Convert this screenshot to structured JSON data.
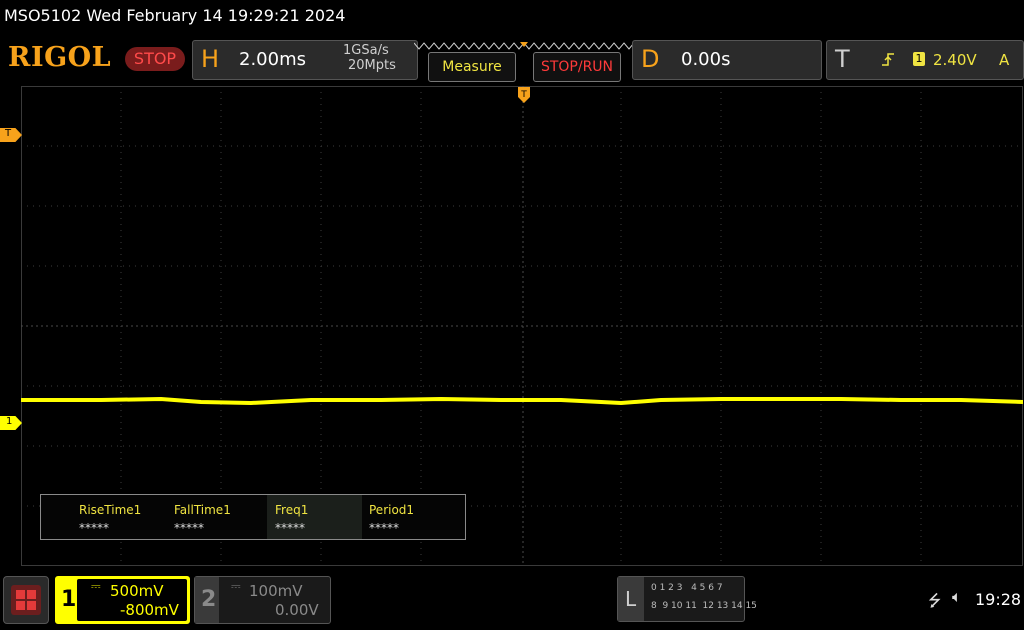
{
  "header": {
    "device_info": "MSO5102  Wed February 14 19:29:21 2024",
    "brand": "RIGOL",
    "run_state": "STOP"
  },
  "horizontal": {
    "letter": "H",
    "timebase": "2.00ms",
    "sample_rate": "1GSa/s",
    "memory_depth": "20Mpts"
  },
  "buttons": {
    "measure": "Measure",
    "stop_run": "STOP/RUN"
  },
  "delay": {
    "letter": "D",
    "value": "0.00s"
  },
  "trigger": {
    "letter": "T",
    "source": "1",
    "level": "2.40V",
    "mode": "A"
  },
  "markers": {
    "trigger_level": "T",
    "channel1": "1"
  },
  "measurements": [
    {
      "name": "RiseTime1",
      "value": "*****"
    },
    {
      "name": "FallTime1",
      "value": "*****"
    },
    {
      "name": "Freq1",
      "value": "*****"
    },
    {
      "name": "Period1",
      "value": "*****"
    }
  ],
  "channels": {
    "ch1": {
      "number": "1",
      "scale": "500mV",
      "offset": "-800mV",
      "color": "#ffff00"
    },
    "ch2": {
      "number": "2",
      "scale": "100mV",
      "offset": "0.00V",
      "color": "#8a8a8a"
    }
  },
  "logic": {
    "letter": "L",
    "row1": "0 1 2 3   4 5 6 7",
    "row2": "8  9 10 11  12 13 14 15"
  },
  "status": {
    "time": "19:28"
  },
  "colors": {
    "accent": "#f7a21b",
    "ch1": "#ffff00",
    "stop_red": "#ff3a3a"
  }
}
